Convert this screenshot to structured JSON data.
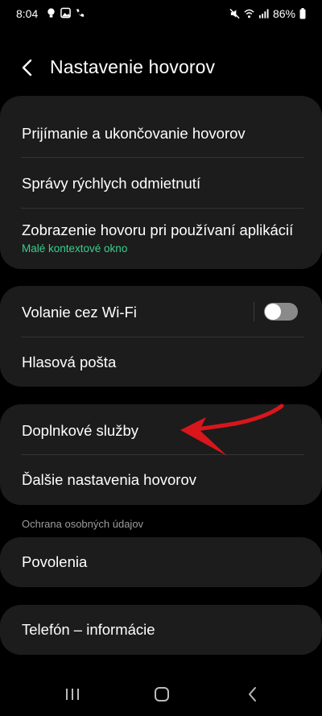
{
  "status_bar": {
    "time": "8:04",
    "battery": "86%",
    "left_icons": [
      "lightbulb-icon",
      "image-icon",
      "wifi-call-icon"
    ],
    "right_icons": [
      "mute-icon",
      "wifi-icon",
      "signal-icon",
      "battery-icon"
    ]
  },
  "header": {
    "title": "Nastavenie hovorov"
  },
  "card1": {
    "items": [
      {
        "label": "Prijímanie a ukončovanie hovorov"
      },
      {
        "label": "Správy rýchlych odmietnutí"
      },
      {
        "label": "Zobrazenie hovoru pri používaní aplikácií",
        "sublabel": "Malé kontextové okno"
      }
    ]
  },
  "card2": {
    "items": [
      {
        "label": "Volanie cez Wi-Fi",
        "toggle": "off"
      },
      {
        "label": "Hlasová pošta"
      }
    ]
  },
  "card3": {
    "items": [
      {
        "label": "Doplnkové služby"
      },
      {
        "label": "Ďalšie nastavenia hovorov"
      }
    ]
  },
  "section_privacy": {
    "label": "Ochrana osobných údajov"
  },
  "card4": {
    "items": [
      {
        "label": "Povolenia"
      }
    ]
  },
  "card5": {
    "items": [
      {
        "label": "Telefón – informácie"
      }
    ]
  },
  "navbar": {
    "buttons": [
      "recents-icon",
      "home-icon",
      "back-nav-icon"
    ]
  },
  "colors": {
    "background": "#000000",
    "card": "#1c1c1c",
    "accent_sub": "#39d08c",
    "annotation_arrow": "#d8161b"
  }
}
